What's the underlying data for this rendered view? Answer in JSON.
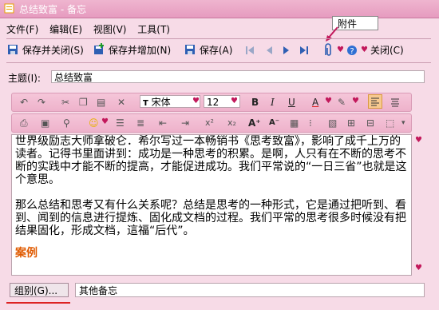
{
  "window": {
    "title": "总结致富 - 备忘"
  },
  "callout": {
    "text": "附件"
  },
  "menu": [
    "文件(F)",
    "编辑(E)",
    "视图(V)",
    "工具(T)"
  ],
  "toolbar": {
    "save_close": "保存并关闭(S)",
    "save_add": "保存并增加(N)",
    "save": "保存(A)",
    "close": "关闭(C)"
  },
  "subject": {
    "label": "主题(I):",
    "value": "总结致富"
  },
  "format": {
    "font": "宋体",
    "size": "12"
  },
  "editor": {
    "paragraphs": [
      "世界级励志大师拿破仑．希尔写过一本畅销书《思考致富》，影响了成千上万的读者。记得书里面讲到：成功是一种思考的积累。是啊，人只有在不断的思考不断的实践中才能不断的提高，才能促进成功。我们平常说的“一日三省”也就是这个意思。",
      "",
      "        那么总结和思考又有什么关系呢？总结是思考的一种形式，它是通过把听到、看到、闻到的信息进行提炼、固化成文档的过程。我们平常的思考很多时候没有把结果固化，形成文档，這福“后代”。",
      "",
      "案例"
    ]
  },
  "bottom": {
    "group_button": "组别(G)...",
    "category_value": "其他备忘"
  },
  "colors": {
    "accent": "#c2185b",
    "window_bg": "#f7dbe7",
    "case_heading": "#e05a00"
  }
}
